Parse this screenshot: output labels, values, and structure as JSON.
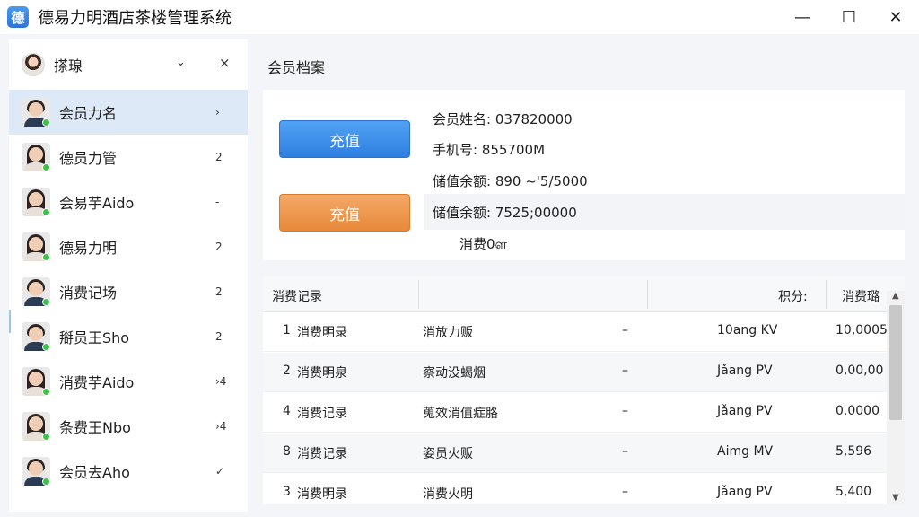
{
  "window": {
    "app_icon_glyph": "德",
    "title": "德易力明酒店茶楼管理系统",
    "minimize": "—",
    "maximize": "☐",
    "close": "✕"
  },
  "sidebar": {
    "user": {
      "name": "搽瑔 ",
      "chevron": "⌄",
      "close": "×"
    },
    "items": [
      {
        "label": "会员力名",
        "badge": "›",
        "gender": "m",
        "active": true
      },
      {
        "label": "德员力管",
        "badge": "2",
        "gender": "f",
        "active": false
      },
      {
        "label": "会易芋Aido",
        "badge": "-",
        "gender": "f",
        "active": false
      },
      {
        "label": "德易力明",
        "badge": "2",
        "gender": "f",
        "active": false
      },
      {
        "label": "消费记场",
        "badge": "2",
        "gender": "m",
        "active": false
      },
      {
        "label": "搿员王Sho",
        "badge": "2",
        "gender": "m",
        "active": false
      },
      {
        "label": "消费芋Aido",
        "badge": "›4",
        "gender": "f",
        "active": false
      },
      {
        "label": "条费王Nbo",
        "badge": "›4",
        "gender": "f",
        "active": false
      },
      {
        "label": "会员去Aho",
        "badge": "✓",
        "gender": "m",
        "active": false
      }
    ]
  },
  "main": {
    "title": "会员档案",
    "buttons": {
      "recharge_primary": "充值",
      "recharge_secondary": "充值"
    },
    "profile": {
      "name": "会员姓名: 037820000",
      "phone": "手机号: 855700M",
      "balance1": "储值余额: 890 ~'5/5000",
      "balance2": "储值余额: 7525;00000",
      "consume": "消费0ள"
    },
    "table": {
      "headers": [
        "消费记录",
        "",
        "",
        "积分:",
        "消费璐"
      ],
      "rows": [
        [
          "1",
          "消费明录",
          "消放力贩",
          "–",
          "10ang KV",
          "10,0005"
        ],
        [
          "2",
          "消费明泉",
          "察动没蝎烟",
          "–",
          "Jǎang PV",
          "0,00,00"
        ],
        [
          "4",
          "消费记录",
          "蒐效消值症胳",
          "–",
          "Jǎang PV",
          "0.0000"
        ],
        [
          "8",
          "消费记录",
          "姿员火贩",
          "–",
          "Aimg MV",
          "5,596"
        ],
        [
          "3",
          "消费明录",
          "消费火明",
          "–",
          "Jǎang PV",
          "5,400"
        ]
      ]
    }
  },
  "colors": {
    "primary_button": "#2f7fe0",
    "secondary_button": "#e8893a",
    "active_item": "#dde9f6",
    "online_dot": "#3cc24a"
  }
}
